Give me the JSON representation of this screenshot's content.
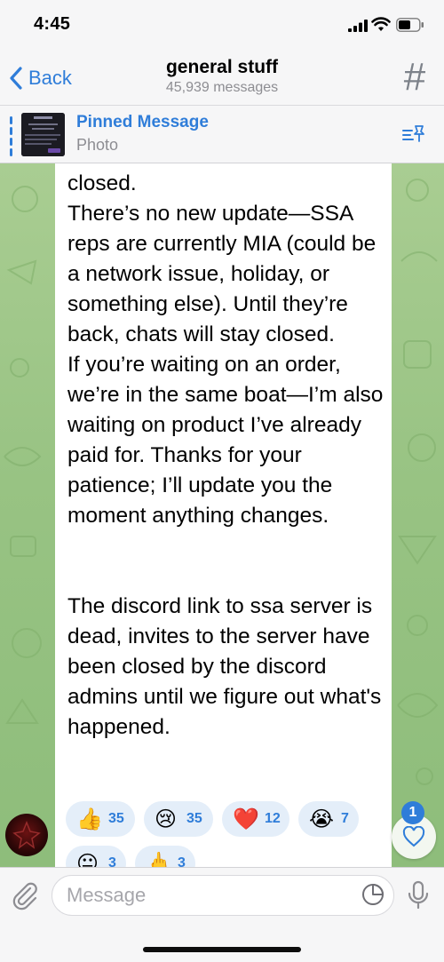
{
  "status_bar": {
    "time": "4:45"
  },
  "header": {
    "back_label": "Back",
    "title": "general stuff",
    "subtitle": "45,939 messages",
    "channel_icon": "#"
  },
  "pinned": {
    "title": "Pinned Message",
    "subtitle": "Photo"
  },
  "message": {
    "text": "closed.\nThere’s no new update—SSA reps are currently MIA (could be a network issue, holiday, or something else). Until they’re back, chats will stay closed.\nIf you’re waiting on an order, we’re in the same boat—I’m also waiting on product I’ve already paid for. Thanks for your patience; I’ll update you the moment anything changes.\n\n\nThe discord link to ssa server is dead, invites to the server have been closed by the discord admins until we figure out what's happened."
  },
  "reactions": [
    {
      "emoji": "👍",
      "count": "35"
    },
    {
      "emoji": "😢",
      "count": "35"
    },
    {
      "emoji": "❤️",
      "count": "12"
    },
    {
      "emoji": "😭",
      "count": "7"
    },
    {
      "emoji": "😐",
      "count": "3"
    },
    {
      "emoji": "🖕",
      "count": "3"
    }
  ],
  "unread_reactions_badge": "1",
  "input": {
    "placeholder": "Message"
  },
  "colors": {
    "accent": "#2f7dd9",
    "chat_bg": "#9cc587"
  }
}
